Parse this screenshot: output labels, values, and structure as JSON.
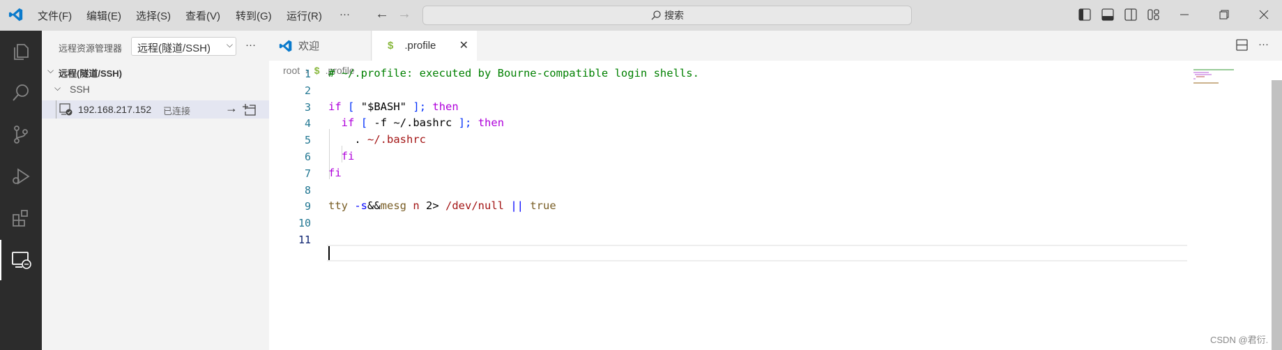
{
  "titlebar": {
    "menus": [
      "文件(F)",
      "编辑(E)",
      "选择(S)",
      "查看(V)",
      "转到(G)",
      "运行(R)",
      "···"
    ],
    "search": "搜索"
  },
  "sidebar": {
    "title": "远程资源管理器",
    "dropdown": "远程(隧道/SSH)",
    "more": "···",
    "section": "远程(隧道/SSH)",
    "group": "SSH",
    "host": "192.168.217.152",
    "host_status": "已连接"
  },
  "tabs": [
    {
      "label": "欢迎"
    },
    {
      "label": ".profile",
      "icon": "$"
    }
  ],
  "breadcrumb": {
    "root": "root",
    "file": ".profile",
    "icon": "$"
  },
  "editor": {
    "line_numbers": [
      "1",
      "2",
      "3",
      "4",
      "5",
      "6",
      "7",
      "8",
      "9",
      "10",
      "11"
    ],
    "lines": [
      [
        {
          "t": "# ~/.profile: executed by Bourne-compatible login shells.",
          "c": "cm"
        }
      ],
      [],
      [
        {
          "t": "if",
          "c": "kw"
        },
        {
          "t": " ",
          "c": "pl"
        },
        {
          "t": "[",
          "c": "pa"
        },
        {
          "t": " \"$BASH\" ",
          "c": "pl"
        },
        {
          "t": "];",
          "c": "pa"
        },
        {
          "t": " ",
          "c": "pl"
        },
        {
          "t": "then",
          "c": "kw"
        }
      ],
      [
        {
          "t": "  ",
          "c": "pl"
        },
        {
          "t": "if",
          "c": "kw"
        },
        {
          "t": " ",
          "c": "pl"
        },
        {
          "t": "[",
          "c": "pa"
        },
        {
          "t": " -f ~/.bashrc ",
          "c": "pl"
        },
        {
          "t": "];",
          "c": "pa"
        },
        {
          "t": " ",
          "c": "pl"
        },
        {
          "t": "then",
          "c": "kw"
        }
      ],
      [
        {
          "t": "    . ",
          "c": "pl"
        },
        {
          "t": "~/.bashrc",
          "c": "str"
        }
      ],
      [
        {
          "t": "  ",
          "c": "pl"
        },
        {
          "t": "fi",
          "c": "kw"
        }
      ],
      [
        {
          "t": "fi",
          "c": "kw"
        }
      ],
      [],
      [
        {
          "t": "tty",
          "c": "fn"
        },
        {
          "t": " -s",
          "c": "op"
        },
        {
          "t": "&&",
          "c": "pl"
        },
        {
          "t": "mesg",
          "c": "fn"
        },
        {
          "t": " n ",
          "c": "str"
        },
        {
          "t": "2> ",
          "c": "pl"
        },
        {
          "t": "/dev/null",
          "c": "str"
        },
        {
          "t": " || ",
          "c": "op"
        },
        {
          "t": "true",
          "c": "fn"
        }
      ],
      [],
      []
    ]
  },
  "watermark": "CSDN @君衍."
}
